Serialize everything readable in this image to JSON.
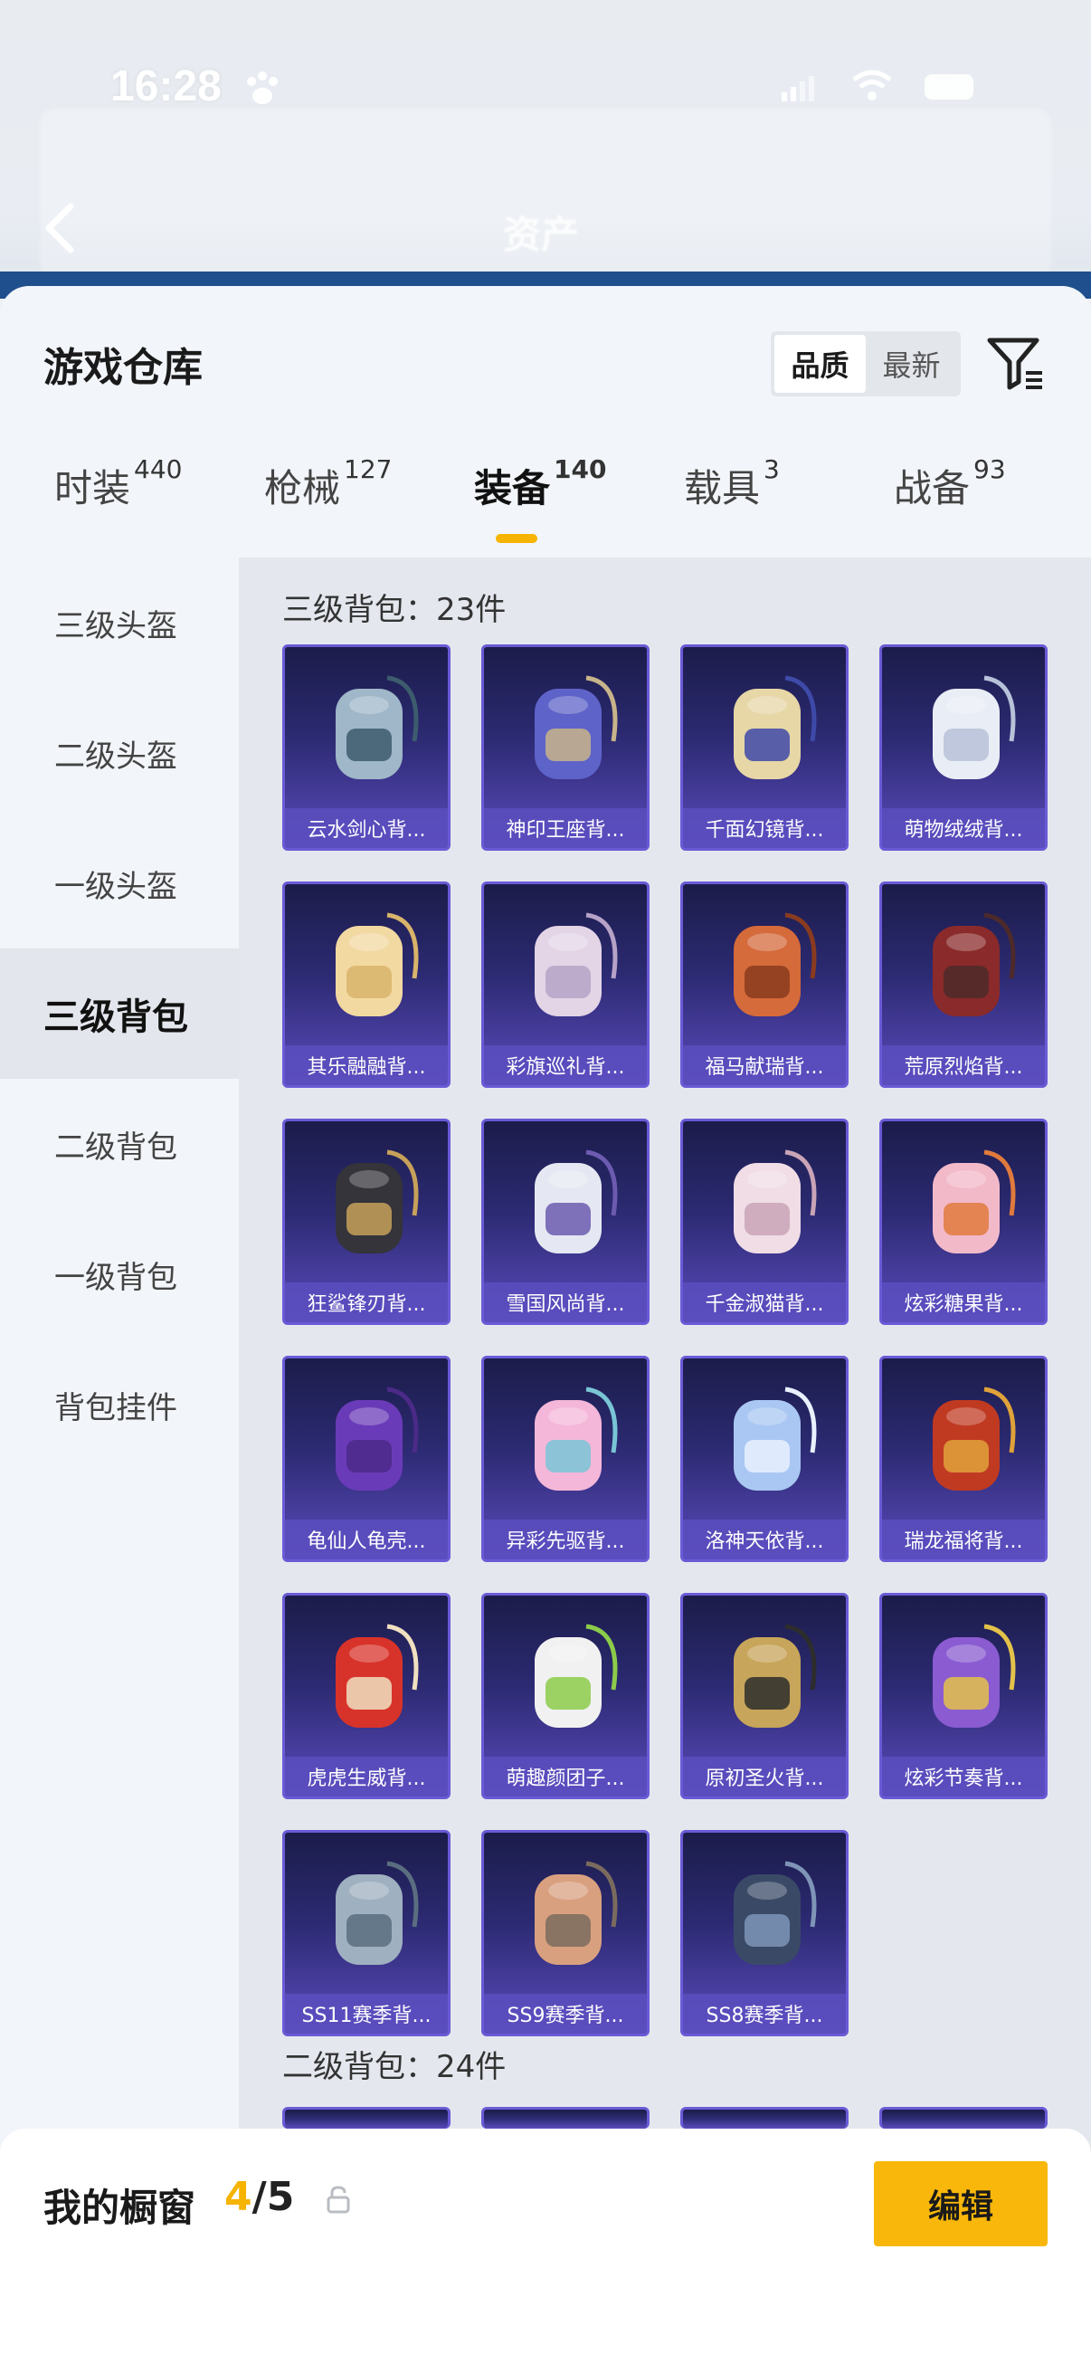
{
  "status_bar": {
    "time": "16:28"
  },
  "header": {
    "title": "资产"
  },
  "warehouse": {
    "title": "游戏仓库",
    "sort_options": [
      {
        "label": "品质",
        "active": true
      },
      {
        "label": "最新",
        "active": false
      }
    ]
  },
  "tabs": [
    {
      "label": "时装",
      "count": "440"
    },
    {
      "label": "枪械",
      "count": "127"
    },
    {
      "label": "装备",
      "count": "140",
      "active": true
    },
    {
      "label": "载具",
      "count": "3"
    },
    {
      "label": "战备",
      "count": "93"
    }
  ],
  "sidebar": {
    "items": [
      {
        "label": "三级头盔"
      },
      {
        "label": "二级头盔"
      },
      {
        "label": "一级头盔"
      },
      {
        "label": "三级背包",
        "active": true
      },
      {
        "label": "二级背包"
      },
      {
        "label": "一级背包"
      },
      {
        "label": "背包挂件"
      }
    ]
  },
  "sections": [
    {
      "title": "三级背包：23件",
      "items": [
        "云水剑心背...",
        "神印王座背...",
        "千面幻镜背...",
        "萌物绒绒背...",
        "其乐融融背...",
        "彩旗巡礼背...",
        "福马献瑞背...",
        "荒原烈焰背...",
        "狂鲨锋刃背...",
        "雪国风尚背...",
        "千金淑猫背...",
        "炫彩糖果背...",
        "龟仙人龟壳...",
        "异彩先驱背...",
        "洛神天依背...",
        "瑞龙福将背...",
        "虎虎生威背...",
        "萌趣颜团子...",
        "原初圣火背...",
        "炫彩节奏背...",
        "SS11赛季背...",
        "SS9赛季背...",
        "SS8赛季背..."
      ]
    },
    {
      "title": "二级背包：24件"
    }
  ],
  "showcase": {
    "label": "我的橱窗",
    "current": "4",
    "separator": "/",
    "total": "5",
    "edit_label": "编辑"
  },
  "colors": {
    "accent": "#f6b300",
    "card_gradient_top": "#1b1c4a",
    "card_gradient_bottom": "#5b4bbd"
  }
}
